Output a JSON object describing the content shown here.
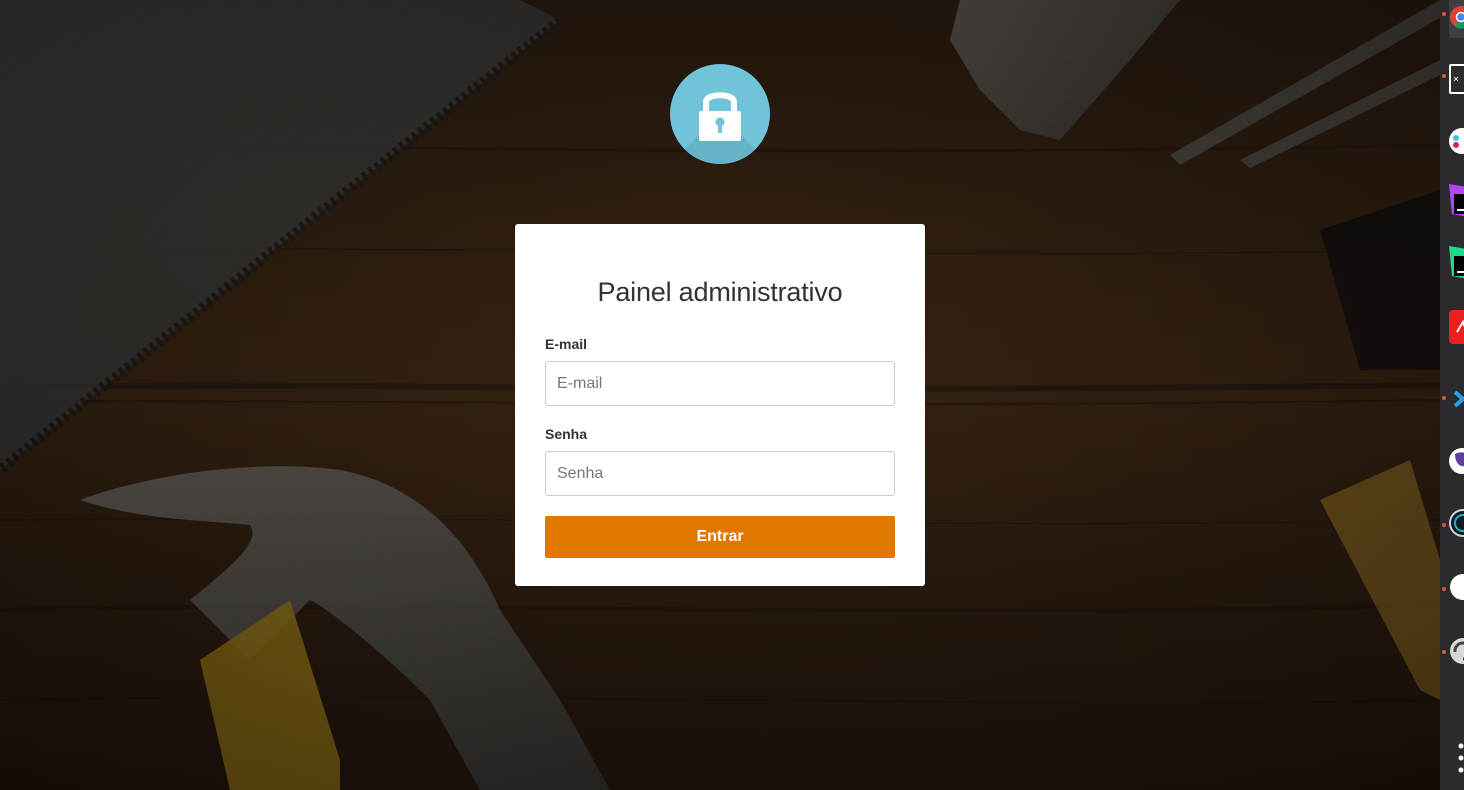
{
  "login": {
    "title": "Painel administrativo",
    "email_label": "E-mail",
    "email_placeholder": "E-mail",
    "email_value": "",
    "password_label": "Senha",
    "password_placeholder": "Senha",
    "password_value": "",
    "submit_label": "Entrar"
  },
  "header": {
    "icon": "lock-icon"
  },
  "dock": {
    "apps": [
      {
        "icon": "chrome-icon",
        "running": true
      },
      {
        "icon": "terminal-icon",
        "running": true
      },
      {
        "icon": "slack-icon",
        "running": false
      },
      {
        "icon": "phpstorm-icon",
        "running": false
      },
      {
        "icon": "pycharm-icon",
        "running": false
      },
      {
        "icon": "acrobat-icon",
        "running": false
      },
      {
        "icon": "vscode-icon",
        "running": true
      },
      {
        "icon": "postgres-icon",
        "running": false
      },
      {
        "icon": "audio-app-icon",
        "running": true
      },
      {
        "icon": "app-circle-icon",
        "running": true
      },
      {
        "icon": "refresh-app-icon",
        "running": true
      }
    ],
    "more_icon": "show-apps-icon"
  },
  "colors": {
    "accent_button": "#e07800",
    "lock_circle": "#70c3d9",
    "dock_background": "#2b2b2e",
    "running_indicator": "#e2553c"
  }
}
